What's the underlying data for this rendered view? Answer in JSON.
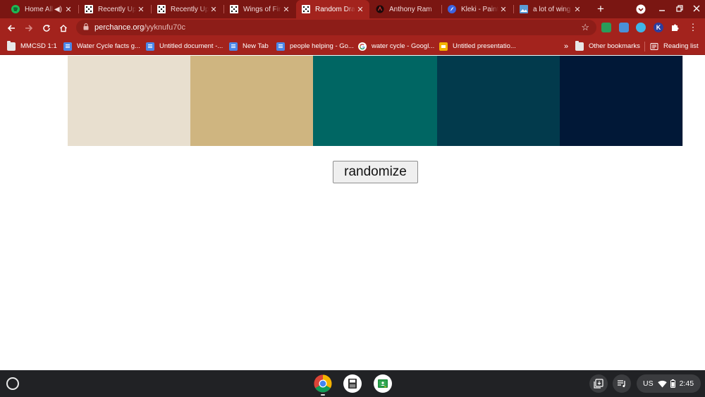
{
  "browser": {
    "tabs": [
      {
        "title": "Home All",
        "favicon": "spotify-icon",
        "audio": true,
        "active": false
      },
      {
        "title": "Recently Upd",
        "favicon": "perchance-dice-icon",
        "active": false
      },
      {
        "title": "Recently Upd",
        "favicon": "perchance-dice-icon",
        "active": false
      },
      {
        "title": "Wings of Fire",
        "favicon": "perchance-dice-icon",
        "active": false
      },
      {
        "title": "Random Drag",
        "favicon": "perchance-dice-icon",
        "active": true
      },
      {
        "title": "Anthony Ram",
        "favicon": "site-icon",
        "active": false
      },
      {
        "title": "Kleki - Paint",
        "favicon": "kleki-icon",
        "active": false
      },
      {
        "title": "a lot of wing",
        "favicon": "image-icon",
        "active": false
      }
    ],
    "close_glyph": "✕",
    "new_tab_glyph": "+",
    "url_host": "perchance.org",
    "url_path": "/yyknufu70c",
    "star_glyph": "☆",
    "extension_k_label": "K",
    "menu_glyph": "⋮",
    "bookmarks": [
      {
        "label": "MMCSD 1:1",
        "icon": "folder-icon"
      },
      {
        "label": "Water Cycle facts g...",
        "icon": "docs-icon"
      },
      {
        "label": "Untitled document -...",
        "icon": "docs-icon"
      },
      {
        "label": "New Tab",
        "icon": "docs-icon"
      },
      {
        "label": "people helping - Go...",
        "icon": "docs-icon"
      },
      {
        "label": "water cycle - Googl...",
        "icon": "google-icon"
      },
      {
        "label": "Untitled presentatio...",
        "icon": "slides-icon"
      }
    ],
    "overflow_glyph": "»",
    "other_bookmarks": "Other bookmarks",
    "reading_list": "Reading list"
  },
  "page": {
    "palette": {
      "colors": [
        "#e8dfcf",
        "#cfb580",
        "#006663",
        "#023a4c",
        "#011837"
      ]
    },
    "randomize_label": "randomize"
  },
  "shelf": {
    "apps": [
      "chrome-icon",
      "files-icon",
      "classroom-icon"
    ],
    "ime": "US",
    "time": "2:45"
  }
}
